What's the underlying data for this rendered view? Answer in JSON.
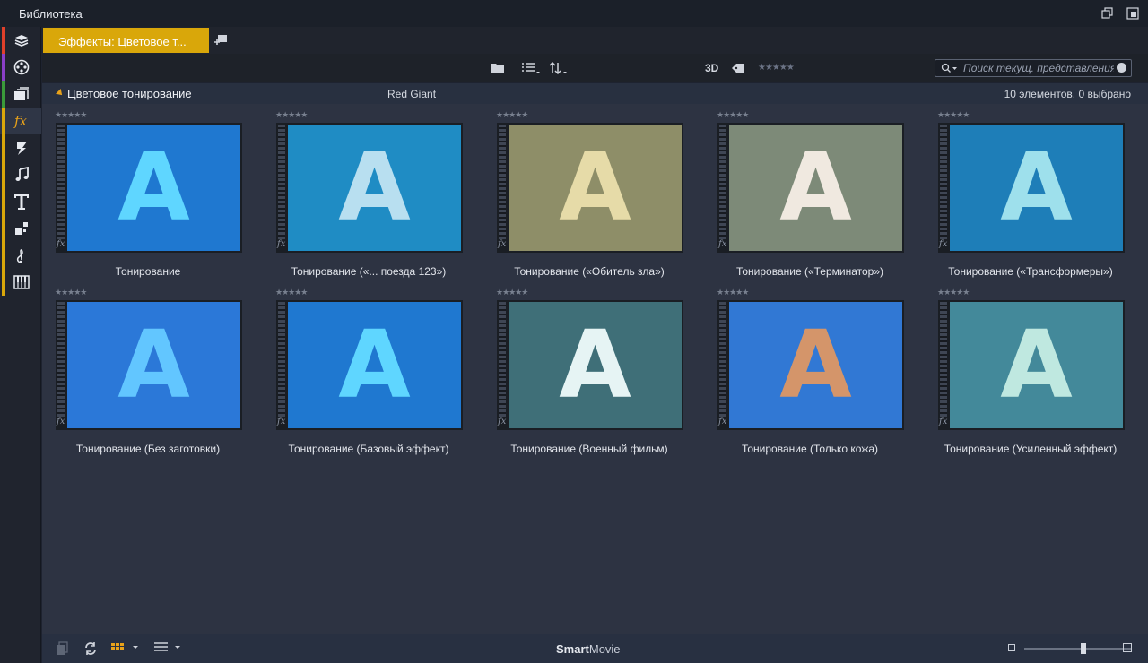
{
  "window": {
    "title": "Библиотека"
  },
  "sidebar": {
    "items": [
      {
        "icon": "box-stack-icon",
        "stripe": "#e0402a"
      },
      {
        "icon": "film-reel-icon",
        "stripe": "#8a3fc8"
      },
      {
        "icon": "clips-icon",
        "stripe": "#3a9a3a"
      },
      {
        "icon": "fx-icon",
        "stripe": "#d9a70a",
        "active": true
      },
      {
        "icon": "transition-icon",
        "stripe": "#d9a70a"
      },
      {
        "icon": "music-note-icon",
        "stripe": "#d9a70a"
      },
      {
        "icon": "title-icon",
        "stripe": "#d9a70a"
      },
      {
        "icon": "montage-icon",
        "stripe": "#d9a70a"
      },
      {
        "icon": "scorefitter-icon",
        "stripe": "#d9a70a"
      },
      {
        "icon": "piano-icon",
        "stripe": "#d9a70a"
      }
    ]
  },
  "tab": {
    "label": "Эффекты: Цветовое т..."
  },
  "toolbar": {
    "three_d": "3D",
    "rating_stars": "★★★★★",
    "search_placeholder": "Поиск текущ. представления"
  },
  "section": {
    "name": "Цветовое тонирование",
    "vendor": "Red Giant",
    "count": "10 элементов, 0 выбрано"
  },
  "items": [
    {
      "label": "Тонирование",
      "bg": "#1f78d0",
      "fg": "#5fd6ff",
      "stars": "★★★★★"
    },
    {
      "label": "Тонирование («... поезда 123»)",
      "bg": "#1f8cc4",
      "fg": "#b8dff0",
      "stars": "★★★★★"
    },
    {
      "label": "Тонирование («Обитель зла»)",
      "bg": "#8e8e68",
      "fg": "#e6dba8",
      "stars": "★★★★★"
    },
    {
      "label": "Тонирование («Терминатор»)",
      "bg": "#7d8a78",
      "fg": "#f0e9e0",
      "stars": "★★★★★"
    },
    {
      "label": "Тонирование («Трансформеры»)",
      "bg": "#1e7eb8",
      "fg": "#9ee0ec",
      "stars": "★★★★★"
    },
    {
      "label": "Тонирование (Без заготовки)",
      "bg": "#2b78d8",
      "fg": "#62c6ff",
      "stars": "★★★★★"
    },
    {
      "label": "Тонирование (Базовый эффект)",
      "bg": "#1f78d0",
      "fg": "#5fd6ff",
      "stars": "★★★★★"
    },
    {
      "label": "Тонирование (Военный фильм)",
      "bg": "#3f6f78",
      "fg": "#e6f4f4",
      "stars": "★★★★★"
    },
    {
      "label": "Тонирование (Только кожа)",
      "bg": "#3178d4",
      "fg": "#d4956a",
      "stars": "★★★★★"
    },
    {
      "label": "Тонирование (Усиленный эффект)",
      "bg": "#43899a",
      "fg": "#bfe8e0",
      "stars": "★★★★★"
    }
  ],
  "bottombar": {
    "brand_bold": "Smart",
    "brand_rest": "Movie",
    "zoom_level": 0.55
  }
}
